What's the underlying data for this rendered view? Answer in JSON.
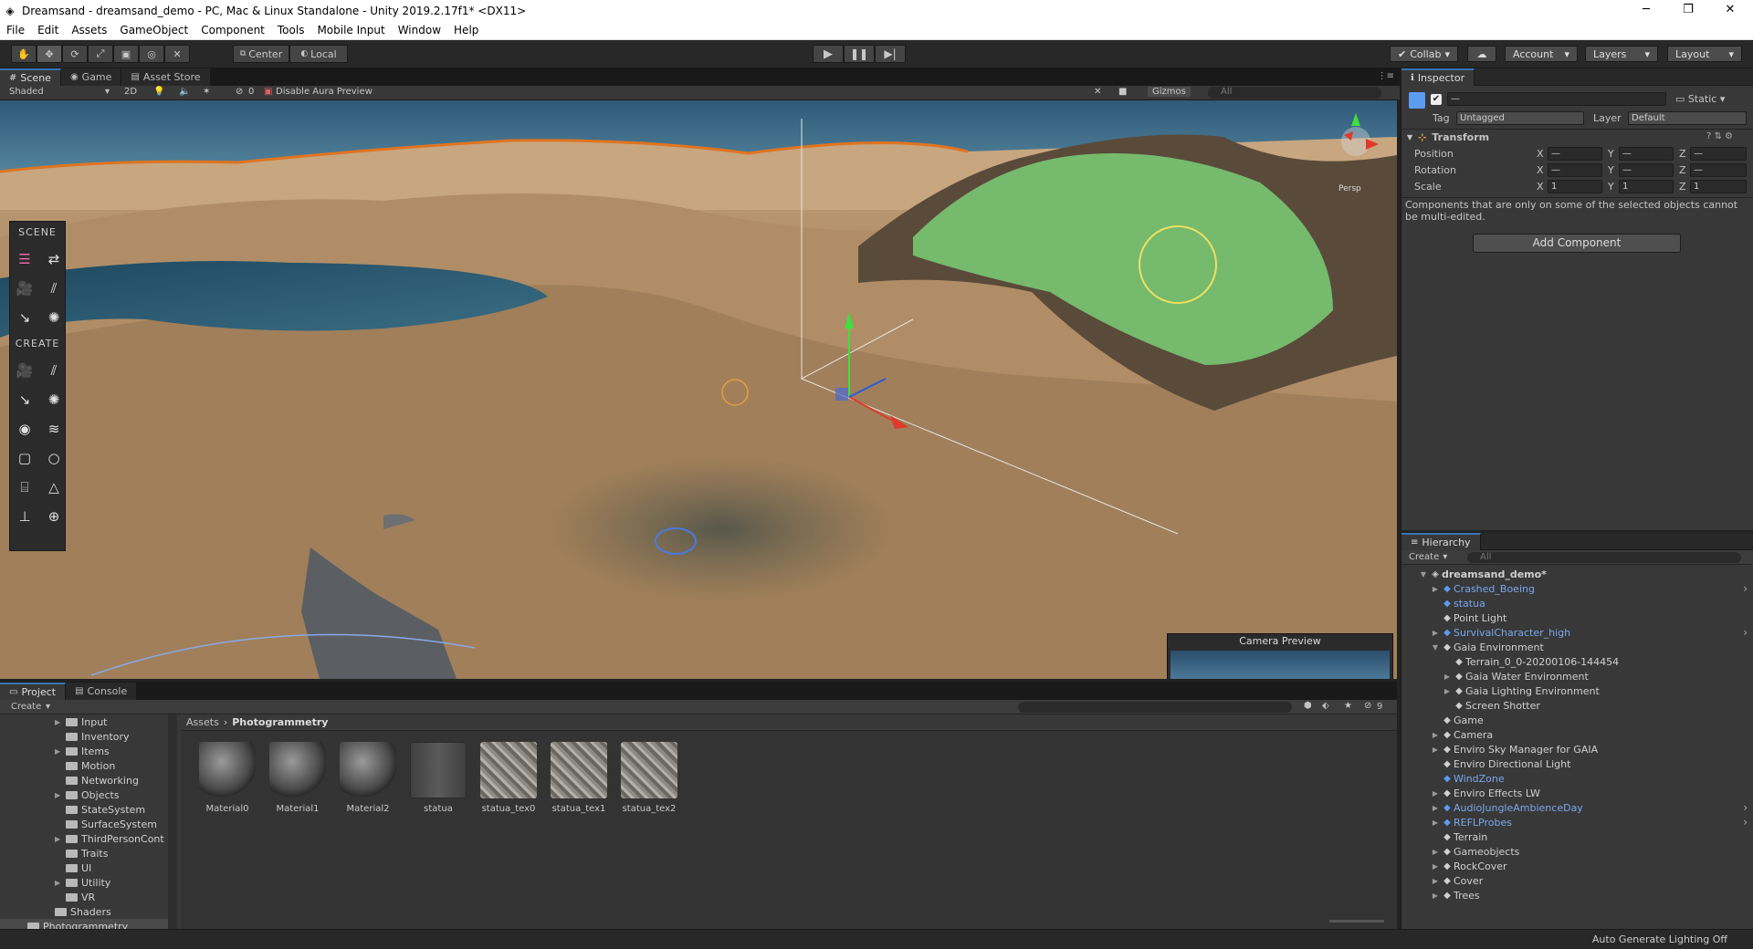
{
  "window": {
    "title": "Dreamsand - dreamsand_demo - PC, Mac & Linux Standalone - Unity 2019.2.17f1* <DX11>",
    "minimize": "─",
    "maximize": "❐",
    "close": "✕"
  },
  "menu": [
    "File",
    "Edit",
    "Assets",
    "GameObject",
    "Component",
    "Tools",
    "Mobile Input",
    "Window",
    "Help"
  ],
  "toolbar": {
    "pivot": "Center",
    "space": "Local",
    "collab": "Collab",
    "account": "Account",
    "layers": "Layers",
    "layout": "Layout"
  },
  "scene_tabs": {
    "scene": "Scene",
    "game": "Game",
    "asset_store": "Asset Store"
  },
  "scene_options": {
    "shading": "Shaded",
    "mode_2d": "2D",
    "hidden_count": "0",
    "aura": "Disable Aura Preview",
    "gizmos": "Gizmos",
    "search_placeholder": "All"
  },
  "scene_palette": {
    "scene_header": "SCENE",
    "create_header": "CREATE"
  },
  "gizmo": {
    "persp": "Persp"
  },
  "camera_preview": {
    "title": "Camera Preview"
  },
  "inspector": {
    "tab": "Inspector",
    "static_label": "Static",
    "tag_label": "Tag",
    "tag_value": "Untagged",
    "layer_label": "Layer",
    "layer_value": "Default",
    "transform": "Transform",
    "position": "Position",
    "rotation": "Rotation",
    "scale": "Scale",
    "axis_x": "X",
    "axis_y": "Y",
    "axis_z": "Z",
    "dash": "—",
    "scale_x": "1",
    "scale_y": "1",
    "scale_z": "1",
    "note": "Components that are only on some of the selected objects cannot be multi-edited.",
    "add_component": "Add Component"
  },
  "hierarchy": {
    "tab": "Hierarchy",
    "create": "Create",
    "search_placeholder": "All",
    "scene_name": "dreamsand_demo*",
    "items": [
      {
        "name": "Crashed_Boeing",
        "prefab": true,
        "expand": true,
        "depth": 1
      },
      {
        "name": "statua",
        "prefab": true,
        "expand": false,
        "depth": 1
      },
      {
        "name": "Point Light",
        "prefab": false,
        "expand": false,
        "depth": 1
      },
      {
        "name": "SurvivalCharacter_high",
        "prefab": true,
        "expand": true,
        "depth": 1
      },
      {
        "name": "Gaia Environment",
        "prefab": false,
        "expand": true,
        "open": true,
        "depth": 1
      },
      {
        "name": "Terrain_0_0-20200106-144454",
        "prefab": false,
        "expand": false,
        "depth": 2
      },
      {
        "name": "Gaia Water Environment",
        "prefab": false,
        "expand": true,
        "depth": 2
      },
      {
        "name": "Gaia Lighting Environment",
        "prefab": false,
        "expand": true,
        "depth": 2
      },
      {
        "name": "Screen Shotter",
        "prefab": false,
        "expand": false,
        "depth": 2
      },
      {
        "name": "Game",
        "prefab": false,
        "expand": false,
        "depth": 1
      },
      {
        "name": "Camera",
        "prefab": false,
        "expand": true,
        "depth": 1
      },
      {
        "name": "Enviro Sky Manager for GAIA",
        "prefab": false,
        "expand": true,
        "depth": 1
      },
      {
        "name": "Enviro Directional Light",
        "prefab": false,
        "expand": false,
        "depth": 1
      },
      {
        "name": "WindZone",
        "prefab": true,
        "expand": false,
        "depth": 1
      },
      {
        "name": "Enviro Effects LW",
        "prefab": false,
        "expand": true,
        "depth": 1
      },
      {
        "name": "AudioJungleAmbienceDay",
        "prefab": true,
        "expand": true,
        "depth": 1
      },
      {
        "name": "REFLProbes",
        "prefab": true,
        "expand": true,
        "depth": 1
      },
      {
        "name": "Terrain",
        "prefab": false,
        "expand": false,
        "depth": 1
      },
      {
        "name": "Gameobjects",
        "prefab": false,
        "expand": true,
        "depth": 1
      },
      {
        "name": "RockCover",
        "prefab": false,
        "expand": true,
        "depth": 1
      },
      {
        "name": "Cover",
        "prefab": false,
        "expand": true,
        "depth": 1
      },
      {
        "name": "Trees",
        "prefab": false,
        "expand": true,
        "depth": 1
      }
    ]
  },
  "project": {
    "tab_project": "Project",
    "tab_console": "Console",
    "create": "Create",
    "hidden_count": "9",
    "breadcrumb_root": "Assets",
    "breadcrumb_sep": "›",
    "breadcrumb_current": "Photogrammetry",
    "folders": [
      {
        "name": "Input",
        "expand": true,
        "depth": 2
      },
      {
        "name": "Inventory",
        "expand": false,
        "depth": 2
      },
      {
        "name": "Items",
        "expand": true,
        "depth": 2
      },
      {
        "name": "Motion",
        "expand": false,
        "depth": 2
      },
      {
        "name": "Networking",
        "expand": false,
        "depth": 2
      },
      {
        "name": "Objects",
        "expand": true,
        "depth": 2
      },
      {
        "name": "StateSystem",
        "expand": false,
        "depth": 2
      },
      {
        "name": "SurfaceSystem",
        "expand": false,
        "depth": 2
      },
      {
        "name": "ThirdPersonCont",
        "expand": true,
        "depth": 2
      },
      {
        "name": "Traits",
        "expand": false,
        "depth": 2
      },
      {
        "name": "UI",
        "expand": false,
        "depth": 2
      },
      {
        "name": "Utility",
        "expand": true,
        "depth": 2
      },
      {
        "name": "VR",
        "expand": false,
        "depth": 2
      },
      {
        "name": "Shaders",
        "expand": false,
        "depth": 1
      },
      {
        "name": "Photogrammetry",
        "expand": false,
        "depth": 0,
        "selected": true
      }
    ],
    "assets": [
      {
        "name": "Material0",
        "kind": "material"
      },
      {
        "name": "Material1",
        "kind": "material"
      },
      {
        "name": "Material2",
        "kind": "material"
      },
      {
        "name": "statua",
        "kind": "model"
      },
      {
        "name": "statua_tex0",
        "kind": "texture"
      },
      {
        "name": "statua_tex1",
        "kind": "texture"
      },
      {
        "name": "statua_tex2",
        "kind": "texture"
      }
    ]
  },
  "status": {
    "auto_lighting": "Auto Generate Lighting Off"
  },
  "colors": {
    "accent": "#3a72b0",
    "prefab": "#79a6ec",
    "panel": "#383838",
    "toolbar": "#282828"
  }
}
